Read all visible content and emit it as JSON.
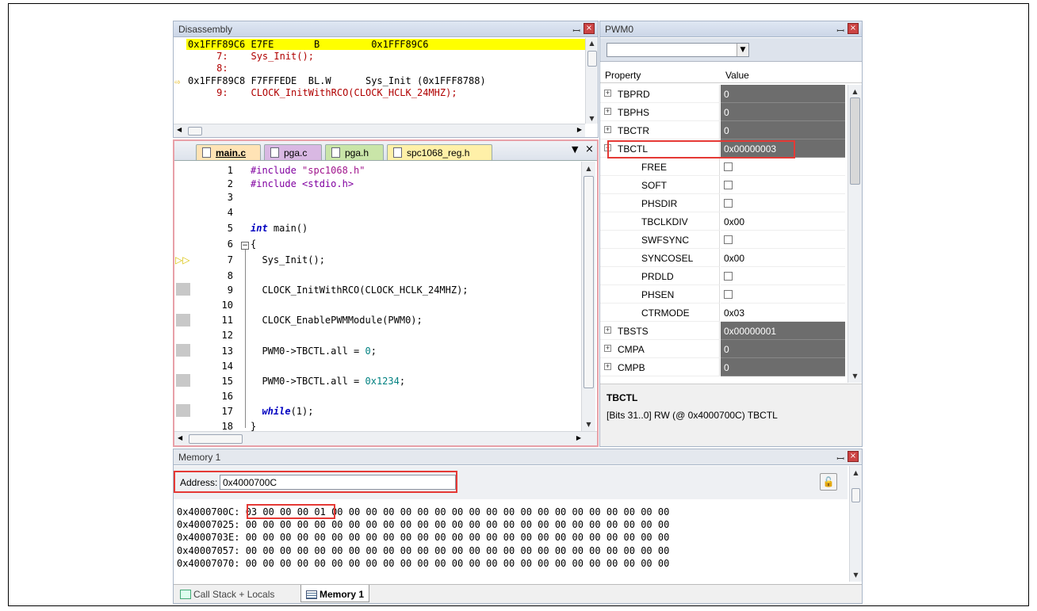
{
  "disassembly": {
    "title": "Disassembly",
    "lines": [
      "0x1FFF89C6 E7FE       B         0x1FFF89C6",
      "     7:    Sys_Init();",
      "     8: ",
      "0x1FFF89C8 F7FFFEDE  BL.W      Sys_Init (0x1FFF8788)",
      "     9:    CLOCK_InitWithRCO(CLOCK_HCLK_24MHZ);"
    ]
  },
  "editor": {
    "tabs": [
      "main.c",
      "pga.c",
      "pga.h",
      "spc1068_reg.h"
    ],
    "lines": [
      {
        "n": "1",
        "c": "#include \"spc1068.h\""
      },
      {
        "n": "2",
        "c": "#include <stdio.h>"
      },
      {
        "n": "3",
        "c": ""
      },
      {
        "n": "4",
        "c": ""
      },
      {
        "n": "5",
        "c": "int main()"
      },
      {
        "n": "6",
        "c": "{"
      },
      {
        "n": "7",
        "c": "  Sys_Init();"
      },
      {
        "n": "8",
        "c": ""
      },
      {
        "n": "9",
        "c": "  CLOCK_InitWithRCO(CLOCK_HCLK_24MHZ);"
      },
      {
        "n": "10",
        "c": ""
      },
      {
        "n": "11",
        "c": "  CLOCK_EnablePWMModule(PWM0);"
      },
      {
        "n": "12",
        "c": ""
      },
      {
        "n": "13",
        "c": "  PWM0->TBCTL.all = 0;"
      },
      {
        "n": "14",
        "c": ""
      },
      {
        "n": "15",
        "c": "  PWM0->TBCTL.all = 0x1234;"
      },
      {
        "n": "16",
        "c": ""
      },
      {
        "n": "17",
        "c": "  while(1);"
      },
      {
        "n": "18",
        "c": "}"
      }
    ]
  },
  "pwm": {
    "title": "PWM0",
    "col_property": "Property",
    "col_value": "Value",
    "rows": [
      {
        "name": "TBPRD",
        "value": "0"
      },
      {
        "name": "TBPHS",
        "value": "0"
      },
      {
        "name": "TBCTR",
        "value": "0"
      },
      {
        "name": "TBCTL",
        "value": "0x00000003"
      },
      {
        "name": "FREE",
        "value": ""
      },
      {
        "name": "SOFT",
        "value": ""
      },
      {
        "name": "PHSDIR",
        "value": ""
      },
      {
        "name": "TBCLKDIV",
        "value": "0x00"
      },
      {
        "name": "SWFSYNC",
        "value": ""
      },
      {
        "name": "SYNCOSEL",
        "value": "0x00"
      },
      {
        "name": "PRDLD",
        "value": ""
      },
      {
        "name": "PHSEN",
        "value": ""
      },
      {
        "name": "CTRMODE",
        "value": "0x03"
      },
      {
        "name": "TBSTS",
        "value": "0x00000001"
      },
      {
        "name": "CMPA",
        "value": "0"
      },
      {
        "name": "CMPB",
        "value": "0"
      }
    ],
    "desc_title": "TBCTL",
    "desc_text": "[Bits 31..0] RW (@ 0x4000700C) TBCTL"
  },
  "memory": {
    "title": "Memory 1",
    "address_label": "Address:",
    "address_value": "0x4000700C",
    "rows": [
      "0x4000700C: 03 00 00 00 01 00 00 00 00 00 00 00 00 00 00 00 00 00 00 00 00 00 00 00 00",
      "0x40007025: 00 00 00 00 00 00 00 00 00 00 00 00 00 00 00 00 00 00 00 00 00 00 00 00 00",
      "0x4000703E: 00 00 00 00 00 00 00 00 00 00 00 00 00 00 00 00 00 00 00 00 00 00 00 00 00",
      "0x40007057: 00 00 00 00 00 00 00 00 00 00 00 00 00 00 00 00 00 00 00 00 00 00 00 00 00",
      "0x40007070: 00 00 00 00 00 00 00 00 00 00 00 00 00 00 00 00 00 00 00 00 00 00 00 00 00"
    ]
  },
  "bottom_tabs": [
    "Call Stack + Locals",
    "Memory 1"
  ],
  "colors": {
    "highlight": "#ffff00",
    "accent": "#e53935",
    "dark_value": "#6d6d6d"
  }
}
